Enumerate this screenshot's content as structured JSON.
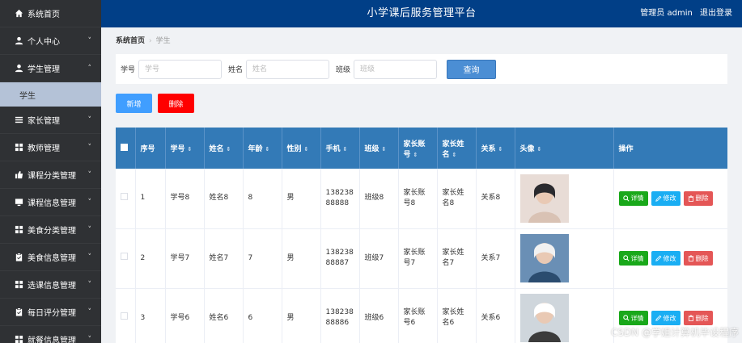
{
  "sidebar": {
    "items": [
      {
        "label": "系统首页",
        "icon": "home-icon",
        "chev": ""
      },
      {
        "label": "个人中心",
        "icon": "user-icon",
        "chev": "˅"
      },
      {
        "label": "学生管理",
        "icon": "user-icon",
        "chev": "˄"
      },
      {
        "label": "家长管理",
        "icon": "list-icon",
        "chev": "˅"
      },
      {
        "label": "教师管理",
        "icon": "grid-icon",
        "chev": "˅"
      },
      {
        "label": "课程分类管理",
        "icon": "thumb-icon",
        "chev": "˅"
      },
      {
        "label": "课程信息管理",
        "icon": "monitor-icon",
        "chev": "˅"
      },
      {
        "label": "美食分类管理",
        "icon": "grid-icon",
        "chev": "˅"
      },
      {
        "label": "美食信息管理",
        "icon": "clipboard-icon",
        "chev": "˅"
      },
      {
        "label": "选课信息管理",
        "icon": "grid-icon",
        "chev": "˅"
      },
      {
        "label": "每日评分管理",
        "icon": "clipboard-icon",
        "chev": "˅"
      },
      {
        "label": "就餐信息管理",
        "icon": "grid-icon",
        "chev": "˅"
      }
    ],
    "sub_item": "学生"
  },
  "header": {
    "title": "小学课后服务管理平台",
    "user_role": "管理员 admin",
    "logout": "退出登录"
  },
  "breadcrumb": {
    "home": "系统首页",
    "sep": "›",
    "current": "学生"
  },
  "search": {
    "fields": [
      {
        "label": "学号",
        "placeholder": "学号"
      },
      {
        "label": "姓名",
        "placeholder": "姓名"
      },
      {
        "label": "班级",
        "placeholder": "班级"
      }
    ],
    "query_label": "查询"
  },
  "actions": {
    "add_label": "新增",
    "delete_label": "删除"
  },
  "table": {
    "headers": [
      "序号",
      "学号",
      "姓名",
      "年龄",
      "性别",
      "手机",
      "班级",
      "家长账号",
      "家长姓名",
      "关系",
      "头像",
      "操作"
    ],
    "sort_glyph": "⇕",
    "rows": [
      {
        "no": "1",
        "sid": "学号8",
        "name": "姓名8",
        "age": "8",
        "gender": "男",
        "phone": "13823888888",
        "class": "班级8",
        "p_acc": "家长账号8",
        "p_name": "家长姓名8",
        "rel": "关系8",
        "avatar_colors": [
          "#e8dcd6",
          "#2a2a2e",
          "#d9c2b4"
        ]
      },
      {
        "no": "2",
        "sid": "学号7",
        "name": "姓名7",
        "age": "7",
        "gender": "男",
        "phone": "13823888887",
        "class": "班级7",
        "p_acc": "家长账号7",
        "p_name": "家长姓名7",
        "rel": "关系7",
        "avatar_colors": [
          "#6a8fb5",
          "#f1f1f1",
          "#2b4c6f"
        ]
      },
      {
        "no": "3",
        "sid": "学号6",
        "name": "姓名6",
        "age": "6",
        "gender": "男",
        "phone": "13823888886",
        "class": "班级6",
        "p_acc": "家长账号6",
        "p_name": "家长姓名6",
        "rel": "关系6",
        "avatar_colors": [
          "#cfd6dc",
          "#ffffff",
          "#3b3b3b"
        ]
      }
    ],
    "ops": {
      "detail": "详情",
      "edit": "修改",
      "delete": "删除"
    }
  },
  "watermark": "CSDN @学姐计算机毕设程序",
  "colors": {
    "sidebar": "#2f3134",
    "header": "#013f87",
    "table_header": "#337ab7",
    "detail": "#19a81a",
    "edit": "#1aaef3",
    "delete": "#e45656"
  }
}
